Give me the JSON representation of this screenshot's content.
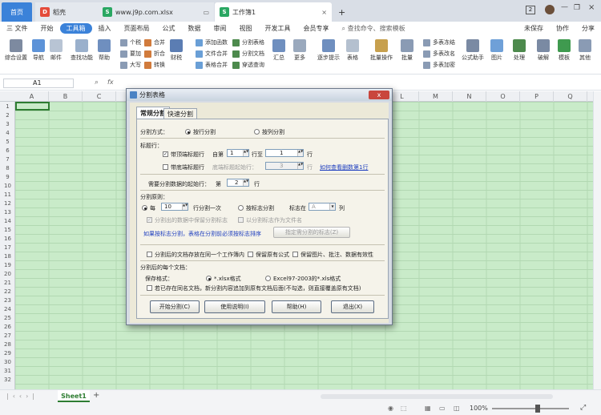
{
  "tabs": {
    "home": "首页",
    "daoke": "稻壳",
    "j9p": "www.j9p.com.xlsx",
    "active": "工作簿1",
    "add": "+"
  },
  "titlebar": {
    "badge": "2"
  },
  "menu": {
    "items": [
      "三 文件",
      "开始",
      "工具箱",
      "插入",
      "页面布局",
      "公式",
      "数据",
      "审阅",
      "视图",
      "开发工具",
      "会员专享"
    ],
    "active_index": 2,
    "search": "查找命令、搜索模板",
    "unsaved": "未保存",
    "collab": "协作",
    "share": "分享"
  },
  "ribbon": {
    "big": [
      "综合设置",
      "导航",
      "邮件",
      "查找功能",
      "帮助",
      "财税",
      "汇总",
      "更多",
      "逐步提示",
      "表格",
      "批量操作",
      "批量",
      "公式助手",
      "图片",
      "处理",
      "破解",
      "模板",
      "其他"
    ],
    "small": [
      "个税",
      "要加",
      "大写",
      "合并",
      "折合",
      "转换",
      "添加函数",
      "文件合并",
      "表格合并",
      "分割表格",
      "分割文档",
      "穿透查询",
      "多表冻结",
      "多表改名",
      "多表加密"
    ]
  },
  "formula_bar": {
    "cell_ref": "A1",
    "fx": "fx"
  },
  "grid": {
    "columns": [
      "A",
      "B",
      "C",
      "D",
      "E",
      "F",
      "G",
      "H",
      "I",
      "J",
      "K",
      "L",
      "M",
      "N",
      "O",
      "P",
      "Q"
    ],
    "rows": [
      "1",
      "2",
      "3",
      "4",
      "5",
      "6",
      "7",
      "8",
      "9",
      "10",
      "11",
      "12",
      "13",
      "14",
      "15",
      "16",
      "17",
      "18",
      "19",
      "20",
      "21",
      "22",
      "23",
      "24",
      "25",
      "26",
      "27",
      "28",
      "29",
      "30",
      "31",
      "32"
    ]
  },
  "sheetbar": {
    "sheet": "Sheet1",
    "add": "+"
  },
  "status": {
    "zoom": "100%"
  },
  "dialog": {
    "title": "分割表格",
    "close": "x",
    "tab_regular": "常规分割",
    "tab_fast": "快速分割",
    "split_mode_label": "分割方式：",
    "by_row": "按行分割",
    "by_col": "按列分割",
    "header_section": "标题行：",
    "with_top_header": "带顶端标题行",
    "from_label": "自第",
    "from_value": "1",
    "to_label": "行至",
    "to_value": "1",
    "row_unit": "行",
    "with_bottom_header": "带底端标题行",
    "bottom_start_label": "底端标题起始行：",
    "bottom_start_value": "3",
    "how_link": "如何查看删数第1行",
    "start_row_label": "需要分割数据的起始行：",
    "start_row_prefix": "第",
    "start_row_value": "2",
    "rule_section": "分割原则：",
    "every_label": "每",
    "every_value": "10",
    "every_suffix": "行分割一次",
    "by_marker": "按标志分割",
    "marker_in": "标志在",
    "marker_col": "A",
    "col_unit": "列",
    "keep_marker": "分割出的数据中保留分割标志",
    "marker_as_name": "以分割标志作为文件名",
    "marker_tip": "如果按标志分割，表格在分割前必须按标志排序",
    "set_marker_button": "指定需分割的标志(Z)",
    "same_workbook": "分割后的文档存放在同一个工作簿内",
    "keep_formula": "保留原有公式",
    "keep_images": "保留图片、批注、数据有效性",
    "per_doc_section": "分割后的每个文档：",
    "save_format_label": "保存格式：",
    "fmt_xlsx": "*.xlsx格式",
    "fmt_xls": "Excel97-2003的*.xls格式",
    "append_tip": "若已存在同名文档，新分割内容追加到原有文档后面(不勾选，则直接覆盖原有文档)",
    "btn_start": "开始分割(C)",
    "btn_instructions": "使用说明(I)",
    "btn_help": "帮助(H)",
    "btn_exit": "退出(X)"
  }
}
